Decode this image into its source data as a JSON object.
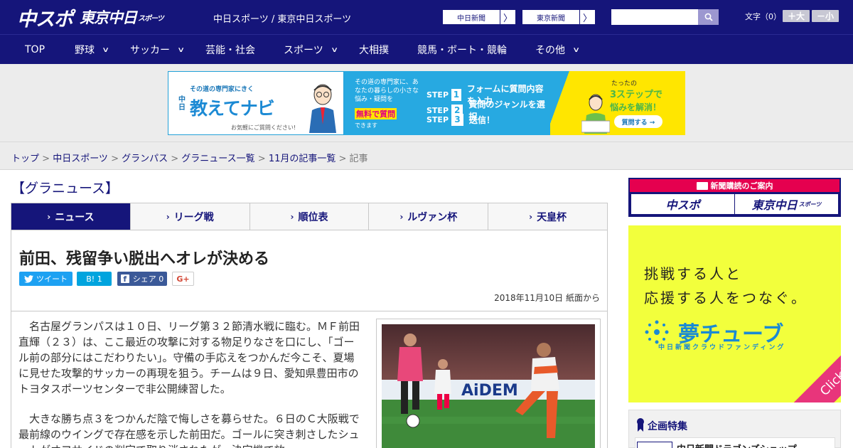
{
  "header": {
    "logo_chuspo": "中スポ",
    "logo_tokyo": "東京中日",
    "logo_tokyo_small": "スポーツ",
    "site_links": "中日スポーツ / 東京中日スポーツ",
    "btn_chunichi": "中日新聞",
    "btn_tokyo": "東京新聞",
    "arrow": "〉",
    "font_label": "文字（0）",
    "font_plus": "＋大",
    "font_minus": "－小",
    "search_icon": "search-icon"
  },
  "nav": {
    "items": [
      {
        "label": "TOP",
        "has_dropdown": false
      },
      {
        "label": "野球",
        "has_dropdown": true
      },
      {
        "label": "サッカー",
        "has_dropdown": true
      },
      {
        "label": "芸能・社会",
        "has_dropdown": false
      },
      {
        "label": "スポーツ",
        "has_dropdown": true
      },
      {
        "label": "大相撲",
        "has_dropdown": false
      },
      {
        "label": "競馬・ボート・競輪",
        "has_dropdown": false
      },
      {
        "label": "その他",
        "has_dropdown": true
      }
    ]
  },
  "ad": {
    "kicker": "その道の専門家にきく",
    "chunichi_vertical": "中日",
    "brand": "教えてナビ",
    "sub": "お気軽にご質問ください!",
    "mid_text": "その道の専門家に、あなたの暮らしの小さな悩み・疑問を",
    "free": "無料で質問",
    "can": "できます",
    "step_word": "STEP",
    "steps": [
      {
        "num": "1",
        "text": "フォームに質問内容を入力"
      },
      {
        "num": "2",
        "text": "質問のジャンルを選択"
      },
      {
        "num": "3",
        "text": "送信！"
      }
    ],
    "tatta": "たったの",
    "three_steps": "3ステップで",
    "kaiketsu": "悩みを解消！",
    "ask_btn": "質問する →"
  },
  "breadcrumb": {
    "items": [
      "トップ",
      "中日スポーツ",
      "グランパス",
      "グラニュース一覧",
      "11月の記事一覧"
    ],
    "current": "記事",
    "sep": " > "
  },
  "section_title": "【グラニュース】",
  "tabs": [
    {
      "label": "ニュース",
      "active": true
    },
    {
      "label": "リーグ戦",
      "active": false
    },
    {
      "label": "順位表",
      "active": false
    },
    {
      "label": "ルヴァン杯",
      "active": false
    },
    {
      "label": "天皇杯",
      "active": false
    }
  ],
  "tab_chev": "›",
  "article": {
    "headline": "前田、残留争い脱出へオレが決める",
    "share_tweet": "ツイート",
    "share_hatena": "B! 1",
    "share_fb": "シェア 0",
    "share_gplus": "G+",
    "dateline": "2018年11月10日 紙面から",
    "p1": "名古屋グランパスは１０日、リーグ第３２節清水戦に臨む。ＭＦ前田直輝（２３）は、ここ最近の攻撃に対する物足りなさを口にし、「ゴール前の部分にはこだわりたい」。守備の手応えをつかんだ今こそ、夏場に見せた攻撃的サッカーの再現を狙う。チームは９日、愛知県豊田市のトヨタスポーツセンターで非公開練習した。",
    "p2": "大きな勝ち点３をつかんだ陰で悔しさを募らせた。６日のＣ大阪戦で最前線のウイングで存在感を示した前田だ。ゴールに突き刺さしたシュートがオフサイドの判定で取り消されたが、決定機で放"
  },
  "photo": {
    "ad_text": "AiDEM"
  },
  "sidebar": {
    "sub_top": "新聞購読のご案内",
    "sub_logo1": "中スポ",
    "sub_logo2": "東京中日",
    "sub_logo2_small": "スポーツ",
    "yume_l1": "挑戦する人と",
    "yume_l2": "応援する人をつなぐ。",
    "yume_logo": "夢チューブ",
    "yume_sub": "中日新聞クラウドファンディング",
    "yume_click": "Click!",
    "kikaku_title": "企画特集",
    "kikaku_item": "中日新聞ドラゴンズショップ"
  },
  "colors": {
    "brand_navy": "#15157a",
    "accent_yellow": "#f2ff3c",
    "accent_pink": "#e5004f"
  }
}
